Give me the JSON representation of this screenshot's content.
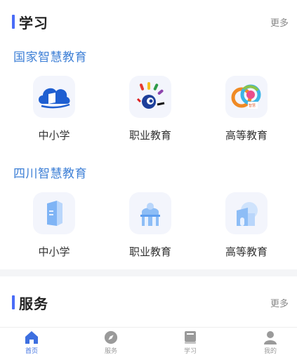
{
  "learning": {
    "title": "学习",
    "more": "更多",
    "groups": [
      {
        "title": "国家智慧教育",
        "items": [
          {
            "label": "中小学",
            "icon": "cloud-book-icon"
          },
          {
            "label": "职业教育",
            "icon": "colorful-logo-icon"
          },
          {
            "label": "高等教育",
            "icon": "rainbow-logo-icon"
          }
        ]
      },
      {
        "title": "四川智慧教育",
        "items": [
          {
            "label": "中小学",
            "icon": "school-door-icon"
          },
          {
            "label": "职业教育",
            "icon": "building-icon"
          },
          {
            "label": "高等教育",
            "icon": "campus-icon"
          }
        ]
      }
    ]
  },
  "services": {
    "title": "服务",
    "more": "更多"
  },
  "tabbar": {
    "items": [
      {
        "label": "首页",
        "icon": "home-icon",
        "active": true
      },
      {
        "label": "服务",
        "icon": "compass-icon",
        "active": false
      },
      {
        "label": "学习",
        "icon": "book-icon",
        "active": false
      },
      {
        "label": "我的",
        "icon": "user-icon",
        "active": false
      }
    ]
  },
  "colors": {
    "accent": "#4a6cf7",
    "group_title": "#3d7fd6",
    "active_tab": "#3d6fe0"
  }
}
